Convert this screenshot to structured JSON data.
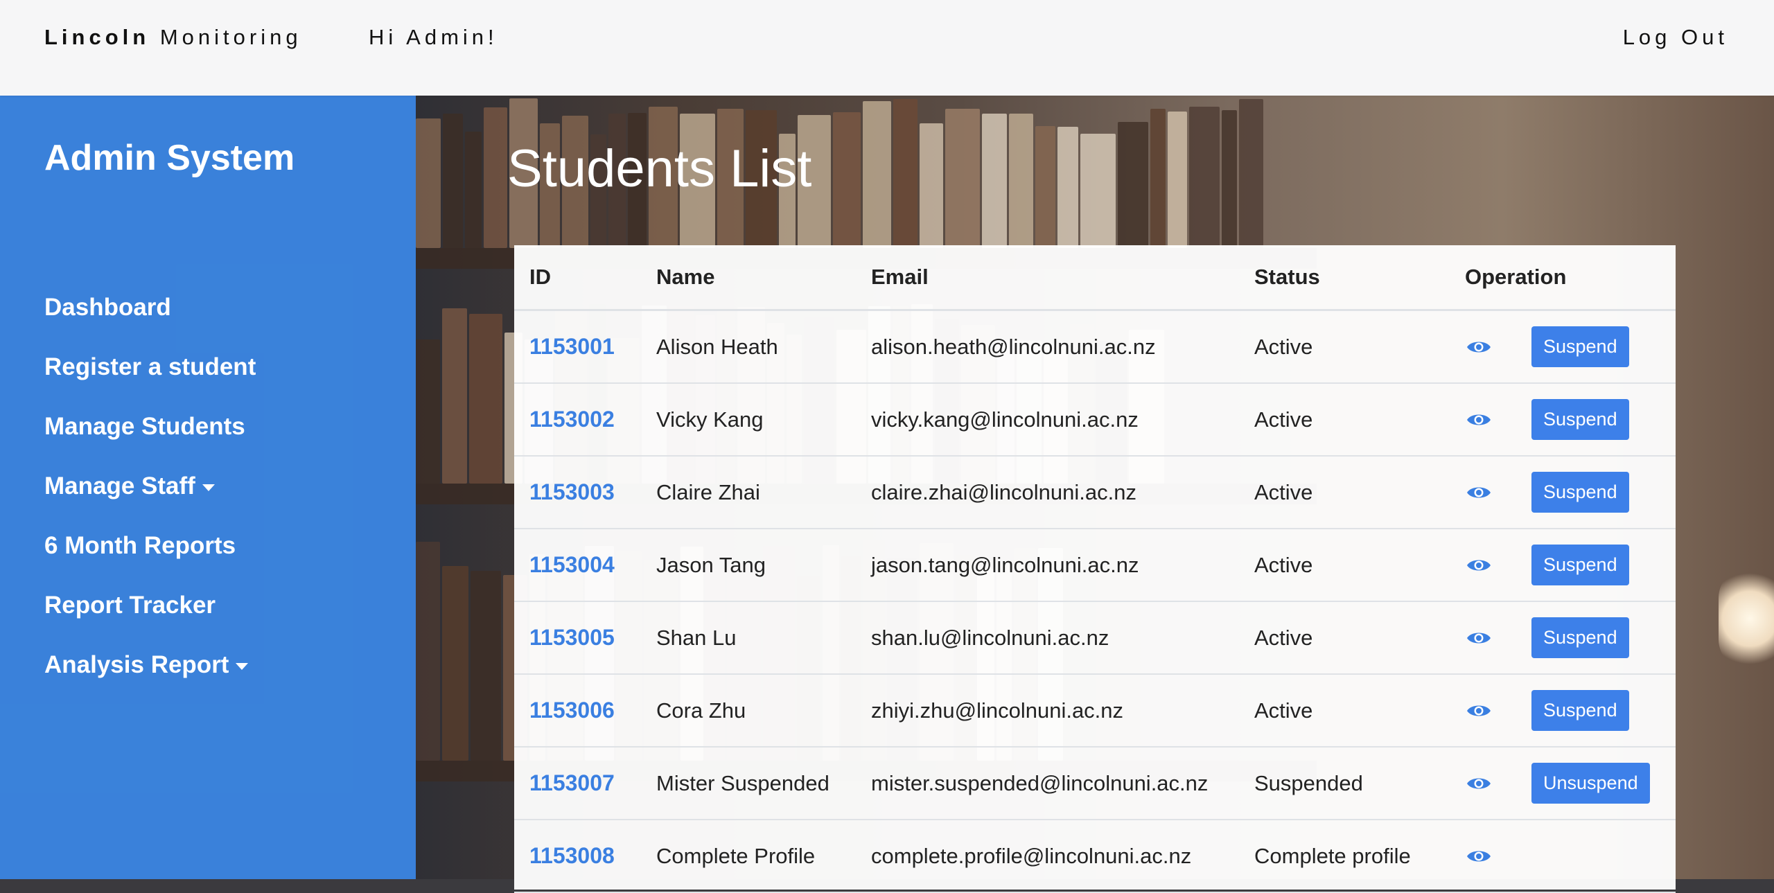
{
  "navbar": {
    "brand_bold": "Lincoln",
    "brand_rest": "Monitoring",
    "greeting": "Hi Admin!",
    "logout_label": "Log Out"
  },
  "sidebar": {
    "title": "Admin System",
    "items": [
      {
        "label": "Dashboard"
      },
      {
        "label": "Register a student"
      },
      {
        "label": "Manage Students"
      },
      {
        "label": "Manage Staff",
        "dropdown": true
      },
      {
        "label": "6 Month Reports"
      },
      {
        "label": "Report Tracker"
      },
      {
        "label": "Analysis Report",
        "dropdown": true
      }
    ]
  },
  "main": {
    "title": "Students List",
    "table": {
      "headers": [
        "ID",
        "Name",
        "Email",
        "Status",
        "Operation"
      ],
      "rows": [
        {
          "id": "1153001",
          "name": "Alison Heath",
          "email": "alison.heath@lincolnuni.ac.nz",
          "status": "Active",
          "action": "Suspend"
        },
        {
          "id": "1153002",
          "name": "Vicky Kang",
          "email": "vicky.kang@lincolnuni.ac.nz",
          "status": "Active",
          "action": "Suspend"
        },
        {
          "id": "1153003",
          "name": "Claire Zhai",
          "email": "claire.zhai@lincolnuni.ac.nz",
          "status": "Active",
          "action": "Suspend"
        },
        {
          "id": "1153004",
          "name": "Jason Tang",
          "email": "jason.tang@lincolnuni.ac.nz",
          "status": "Active",
          "action": "Suspend"
        },
        {
          "id": "1153005",
          "name": "Shan Lu",
          "email": "shan.lu@lincolnuni.ac.nz",
          "status": "Active",
          "action": "Suspend"
        },
        {
          "id": "1153006",
          "name": "Cora Zhu",
          "email": "zhiyi.zhu@lincolnuni.ac.nz",
          "status": "Active",
          "action": "Suspend"
        },
        {
          "id": "1153007",
          "name": "Mister Suspended",
          "email": "mister.suspended@lincolnuni.ac.nz",
          "status": "Suspended",
          "action": "Unsuspend"
        },
        {
          "id": "1153008",
          "name": "Complete Profile",
          "email": "complete.profile@lincolnuni.ac.nz",
          "status": "Complete profile",
          "action": ""
        }
      ]
    }
  },
  "colors": {
    "accent": "#3a7fe1",
    "sidebar": "#3a87e6",
    "button": "#3d80e9"
  },
  "icons": {
    "view": "eye-icon"
  }
}
